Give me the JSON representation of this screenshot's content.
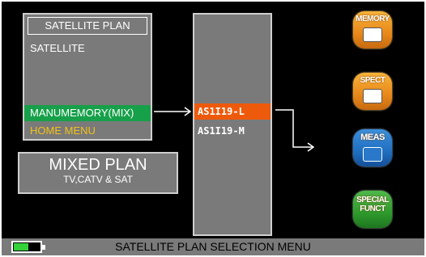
{
  "menu": {
    "title": "SATELLITE PLAN",
    "items": [
      {
        "label": "SATELLITE"
      },
      {
        "label": "MANUMEMORY(MIX)",
        "selected": true,
        "color": "#17a04a"
      },
      {
        "label": "HOME MENU",
        "color": "#f2c21a"
      }
    ]
  },
  "mixed_plan": {
    "title": "MIXED PLAN",
    "subtitle": "TV,CATV & SAT"
  },
  "plan_list": {
    "items": [
      {
        "label": "AS1I19-L",
        "selected": true,
        "color": "#ee5a0b"
      },
      {
        "label": "AS1I19-M"
      }
    ]
  },
  "side_buttons": [
    {
      "label": "MEMORY",
      "icon": "memory-icon",
      "color": "#e8881a"
    },
    {
      "label": "SPECT",
      "icon": "spectrum-icon",
      "color": "#e8881a"
    },
    {
      "label": "MEAS",
      "icon": "measure-icon",
      "color": "#1f6fc0"
    },
    {
      "label": "SPECIAL FUNCT",
      "icon": "special-function-icon",
      "color": "#2e9a2c"
    }
  ],
  "status_bar": {
    "text": "SATELLITE PLAN SELECTION MENU",
    "battery_level": 0.55,
    "battery_color": "#35d13a"
  }
}
